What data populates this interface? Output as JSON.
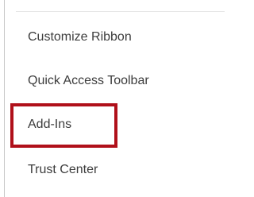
{
  "options_nav": {
    "items": [
      {
        "label": "Customize Ribbon"
      },
      {
        "label": "Quick Access Toolbar"
      },
      {
        "label": "Add-Ins"
      },
      {
        "label": "Trust Center"
      }
    ],
    "highlighted_item": "Add-Ins",
    "highlight_color": "#b0101a"
  }
}
